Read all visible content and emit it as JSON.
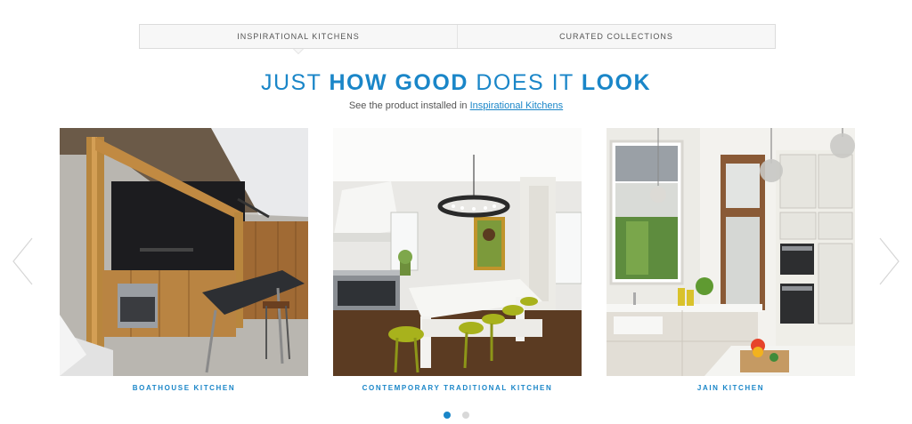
{
  "tabs": [
    {
      "label": "INSPIRATIONAL KITCHENS",
      "active": true
    },
    {
      "label": "CURATED COLLECTIONS",
      "active": false
    }
  ],
  "headline": {
    "part1": "JUST ",
    "part2": "HOW GOOD",
    "part3": " DOES IT ",
    "part4": "LOOK"
  },
  "subline": {
    "text": "See the product installed in ",
    "link": "Inspirational Kitchens"
  },
  "cards": [
    {
      "caption": "BOATHOUSE KITCHEN"
    },
    {
      "caption": "CONTEMPORARY TRADITIONAL KITCHEN"
    },
    {
      "caption": "JAIN KITCHEN"
    }
  ],
  "carousel": {
    "prev_icon": "chevron-left-icon",
    "next_icon": "chevron-right-icon",
    "page_count": 2,
    "active_page": 1
  },
  "colors": {
    "accent": "#1a86c8",
    "tab_bg": "#f7f7f7",
    "dot_inactive": "#d8d8d8"
  }
}
